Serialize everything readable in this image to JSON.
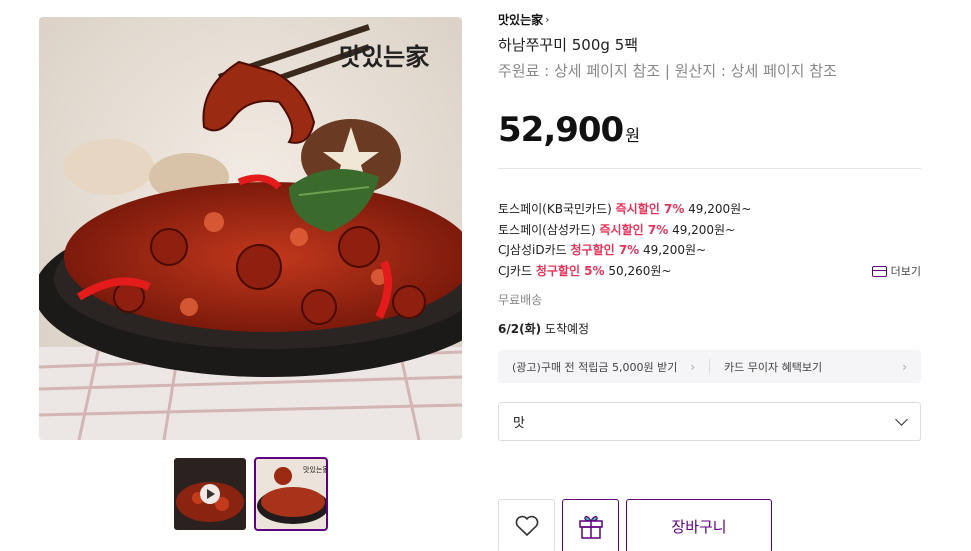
{
  "product": {
    "brand": "맛있는家",
    "brand_chevron": "›",
    "title": "하남쭈꾸미 500g 5팩",
    "subtitle": "주원료 : 상세 페이지 참조 | 원산지 : 상세 페이지 참조",
    "price": "52,900",
    "price_unit": "원",
    "image_logo": "맛있는家"
  },
  "benefits": [
    {
      "prefix": "토스페이(KB국민카드)",
      "highlight": "즉시할인 7%",
      "suffix": "49,200원~"
    },
    {
      "prefix": "토스페이(삼성카드)",
      "highlight": "즉시할인 7%",
      "suffix": "49,200원~"
    },
    {
      "prefix": "CJ삼성iD카드",
      "highlight": "청구할인 7%",
      "suffix": "49,200원~"
    },
    {
      "prefix": "CJ카드",
      "highlight": "청구할인 5%",
      "suffix": "50,260원~"
    }
  ],
  "more_label": "더보기",
  "shipping": "무료배송",
  "arrival": {
    "date": "6/2(화)",
    "text": "도착예정"
  },
  "promo": {
    "left": "(광고)구매 전 적립금 5,000원 받기",
    "right": "카드 무이자 혜택보기",
    "arrow": "›"
  },
  "option_select": {
    "selected": "맛"
  },
  "actions": {
    "cart_label": "장바구니"
  },
  "colors": {
    "accent": "#5f0080",
    "discount": "#e8345a"
  },
  "icons": [
    "chevron-right-icon",
    "card-icon",
    "chevron-down-icon",
    "heart-icon",
    "gift-icon",
    "play-icon"
  ]
}
